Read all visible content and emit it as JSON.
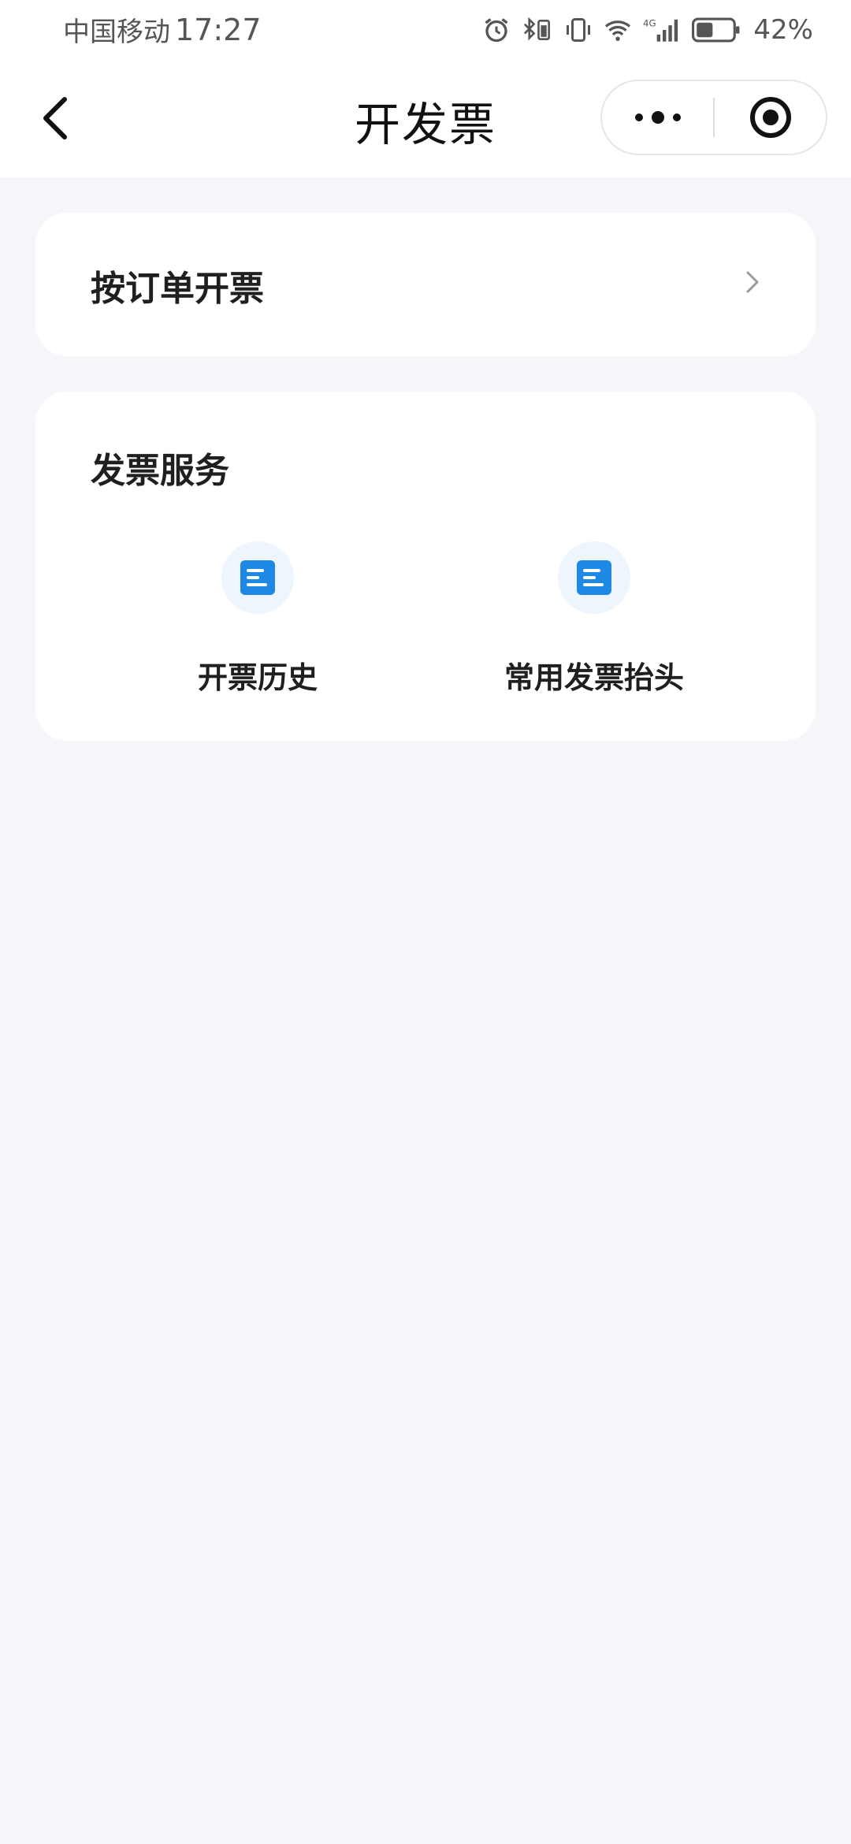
{
  "status_bar": {
    "carrier": "中国移动",
    "time": "17:27",
    "network": "4G",
    "battery": "42%"
  },
  "nav": {
    "title": "开发票"
  },
  "order_invoice": {
    "label": "按订单开票"
  },
  "services": {
    "title": "发票服务",
    "items": [
      {
        "label": "开票历史",
        "icon": "document-icon"
      },
      {
        "label": "常用发票抬头",
        "icon": "document-icon"
      }
    ]
  },
  "colors": {
    "accent": "#1e88e5",
    "icon_bg": "#eef5fd",
    "page_bg": "#f5f6fa"
  }
}
